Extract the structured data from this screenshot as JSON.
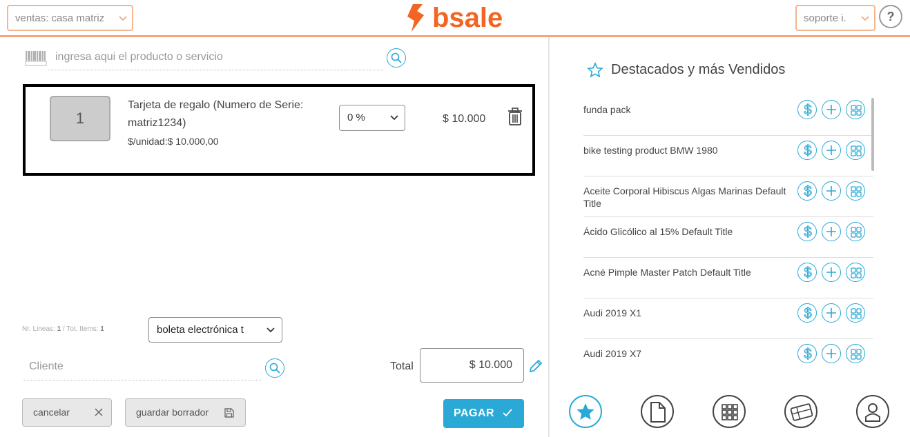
{
  "header": {
    "branch_select": "ventas: casa matriz",
    "brand": "bsale",
    "user_select": "soporte i.",
    "help": "?"
  },
  "search": {
    "placeholder": "ingresa aqui el producto o servicio"
  },
  "item": {
    "quantity": "1",
    "name": "Tarjeta de regalo (Numero de Serie: matriz1234)",
    "unit_price": "$/unidad:$ 10.000,00",
    "discount": "0 %",
    "total": "$ 10.000"
  },
  "counts": {
    "lines_label": "Nr. Lineas: ",
    "lines": "1",
    "sep": " / Tot. Items: ",
    "items": "1"
  },
  "document_type": "boleta electrónica t",
  "client": {
    "placeholder": "Cliente"
  },
  "total": {
    "label": "Total",
    "value": "$ 10.000"
  },
  "buttons": {
    "cancel": "cancelar",
    "draft": "guardar borrador",
    "pay": "PAGAR"
  },
  "favorites": {
    "title": "Destacados y más Vendidos",
    "items": [
      {
        "name": "funda pack"
      },
      {
        "name": "bike testing product BMW 1980"
      },
      {
        "name": "Aceite Corporal Hibiscus Algas Marinas Default Title"
      },
      {
        "name": "Ácido Glicólico al 15% Default Title"
      },
      {
        "name": "Acné Pimple Master Patch Default Title"
      },
      {
        "name": "Audi 2019 X1"
      },
      {
        "name": "Audi 2019 X7"
      }
    ]
  },
  "colors": {
    "brand": "#f26522",
    "accent": "#2aa9d6",
    "header_border": "#f5a77c"
  },
  "icons": [
    "chevron-down-icon",
    "barcode-icon",
    "search-icon",
    "trash-icon",
    "pencil-icon",
    "close-icon",
    "save-icon",
    "check-icon",
    "star-icon",
    "dollar-icon",
    "plus-icon",
    "variants-icon",
    "document-icon",
    "grid-icon",
    "gift-card-icon",
    "user-icon"
  ]
}
